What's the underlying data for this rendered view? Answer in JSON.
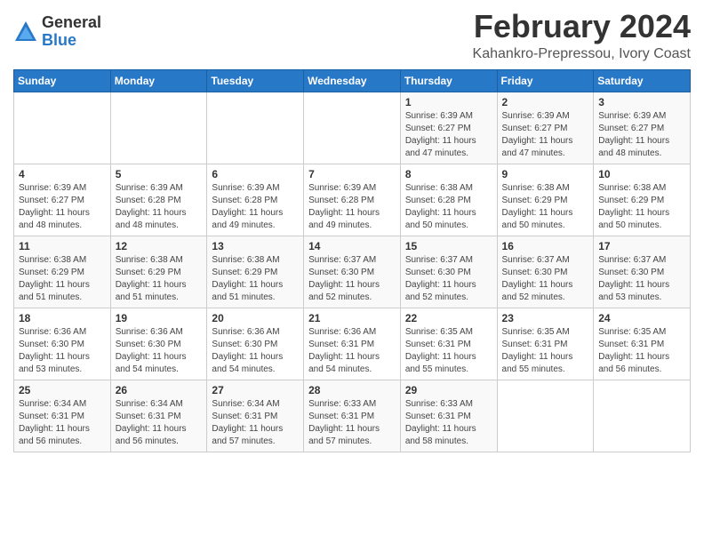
{
  "logo": {
    "general": "General",
    "blue": "Blue"
  },
  "title": {
    "month": "February 2024",
    "location": "Kahankro-Prepressou, Ivory Coast"
  },
  "headers": [
    "Sunday",
    "Monday",
    "Tuesday",
    "Wednesday",
    "Thursday",
    "Friday",
    "Saturday"
  ],
  "weeks": [
    [
      {
        "day": "",
        "info": ""
      },
      {
        "day": "",
        "info": ""
      },
      {
        "day": "",
        "info": ""
      },
      {
        "day": "",
        "info": ""
      },
      {
        "day": "1",
        "info": "Sunrise: 6:39 AM\nSunset: 6:27 PM\nDaylight: 11 hours and 47 minutes."
      },
      {
        "day": "2",
        "info": "Sunrise: 6:39 AM\nSunset: 6:27 PM\nDaylight: 11 hours and 47 minutes."
      },
      {
        "day": "3",
        "info": "Sunrise: 6:39 AM\nSunset: 6:27 PM\nDaylight: 11 hours and 48 minutes."
      }
    ],
    [
      {
        "day": "4",
        "info": "Sunrise: 6:39 AM\nSunset: 6:27 PM\nDaylight: 11 hours and 48 minutes."
      },
      {
        "day": "5",
        "info": "Sunrise: 6:39 AM\nSunset: 6:28 PM\nDaylight: 11 hours and 48 minutes."
      },
      {
        "day": "6",
        "info": "Sunrise: 6:39 AM\nSunset: 6:28 PM\nDaylight: 11 hours and 49 minutes."
      },
      {
        "day": "7",
        "info": "Sunrise: 6:39 AM\nSunset: 6:28 PM\nDaylight: 11 hours and 49 minutes."
      },
      {
        "day": "8",
        "info": "Sunrise: 6:38 AM\nSunset: 6:28 PM\nDaylight: 11 hours and 50 minutes."
      },
      {
        "day": "9",
        "info": "Sunrise: 6:38 AM\nSunset: 6:29 PM\nDaylight: 11 hours and 50 minutes."
      },
      {
        "day": "10",
        "info": "Sunrise: 6:38 AM\nSunset: 6:29 PM\nDaylight: 11 hours and 50 minutes."
      }
    ],
    [
      {
        "day": "11",
        "info": "Sunrise: 6:38 AM\nSunset: 6:29 PM\nDaylight: 11 hours and 51 minutes."
      },
      {
        "day": "12",
        "info": "Sunrise: 6:38 AM\nSunset: 6:29 PM\nDaylight: 11 hours and 51 minutes."
      },
      {
        "day": "13",
        "info": "Sunrise: 6:38 AM\nSunset: 6:29 PM\nDaylight: 11 hours and 51 minutes."
      },
      {
        "day": "14",
        "info": "Sunrise: 6:37 AM\nSunset: 6:30 PM\nDaylight: 11 hours and 52 minutes."
      },
      {
        "day": "15",
        "info": "Sunrise: 6:37 AM\nSunset: 6:30 PM\nDaylight: 11 hours and 52 minutes."
      },
      {
        "day": "16",
        "info": "Sunrise: 6:37 AM\nSunset: 6:30 PM\nDaylight: 11 hours and 52 minutes."
      },
      {
        "day": "17",
        "info": "Sunrise: 6:37 AM\nSunset: 6:30 PM\nDaylight: 11 hours and 53 minutes."
      }
    ],
    [
      {
        "day": "18",
        "info": "Sunrise: 6:36 AM\nSunset: 6:30 PM\nDaylight: 11 hours and 53 minutes."
      },
      {
        "day": "19",
        "info": "Sunrise: 6:36 AM\nSunset: 6:30 PM\nDaylight: 11 hours and 54 minutes."
      },
      {
        "day": "20",
        "info": "Sunrise: 6:36 AM\nSunset: 6:30 PM\nDaylight: 11 hours and 54 minutes."
      },
      {
        "day": "21",
        "info": "Sunrise: 6:36 AM\nSunset: 6:31 PM\nDaylight: 11 hours and 54 minutes."
      },
      {
        "day": "22",
        "info": "Sunrise: 6:35 AM\nSunset: 6:31 PM\nDaylight: 11 hours and 55 minutes."
      },
      {
        "day": "23",
        "info": "Sunrise: 6:35 AM\nSunset: 6:31 PM\nDaylight: 11 hours and 55 minutes."
      },
      {
        "day": "24",
        "info": "Sunrise: 6:35 AM\nSunset: 6:31 PM\nDaylight: 11 hours and 56 minutes."
      }
    ],
    [
      {
        "day": "25",
        "info": "Sunrise: 6:34 AM\nSunset: 6:31 PM\nDaylight: 11 hours and 56 minutes."
      },
      {
        "day": "26",
        "info": "Sunrise: 6:34 AM\nSunset: 6:31 PM\nDaylight: 11 hours and 56 minutes."
      },
      {
        "day": "27",
        "info": "Sunrise: 6:34 AM\nSunset: 6:31 PM\nDaylight: 11 hours and 57 minutes."
      },
      {
        "day": "28",
        "info": "Sunrise: 6:33 AM\nSunset: 6:31 PM\nDaylight: 11 hours and 57 minutes."
      },
      {
        "day": "29",
        "info": "Sunrise: 6:33 AM\nSunset: 6:31 PM\nDaylight: 11 hours and 58 minutes."
      },
      {
        "day": "",
        "info": ""
      },
      {
        "day": "",
        "info": ""
      }
    ]
  ]
}
